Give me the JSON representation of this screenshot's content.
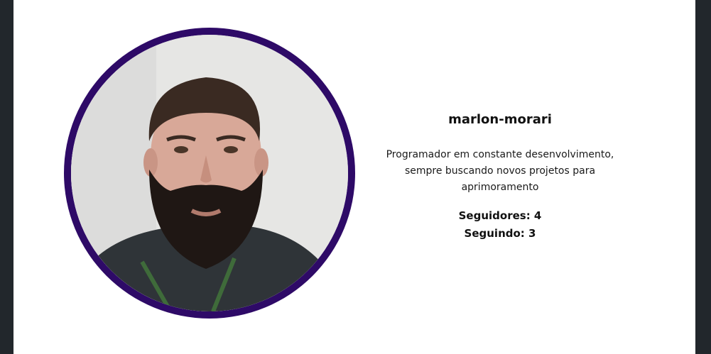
{
  "profile": {
    "username": "marlon-morari",
    "bio": "Programador em constante desenvolvimento, sempre buscando novos projetos para aprimoramento",
    "followers_label": "Seguidores: 4",
    "following_label": "Seguindo: 3"
  },
  "colors": {
    "page_background": "#22272c",
    "card_background": "#ffffff",
    "avatar_ring": "#2e0a67"
  }
}
